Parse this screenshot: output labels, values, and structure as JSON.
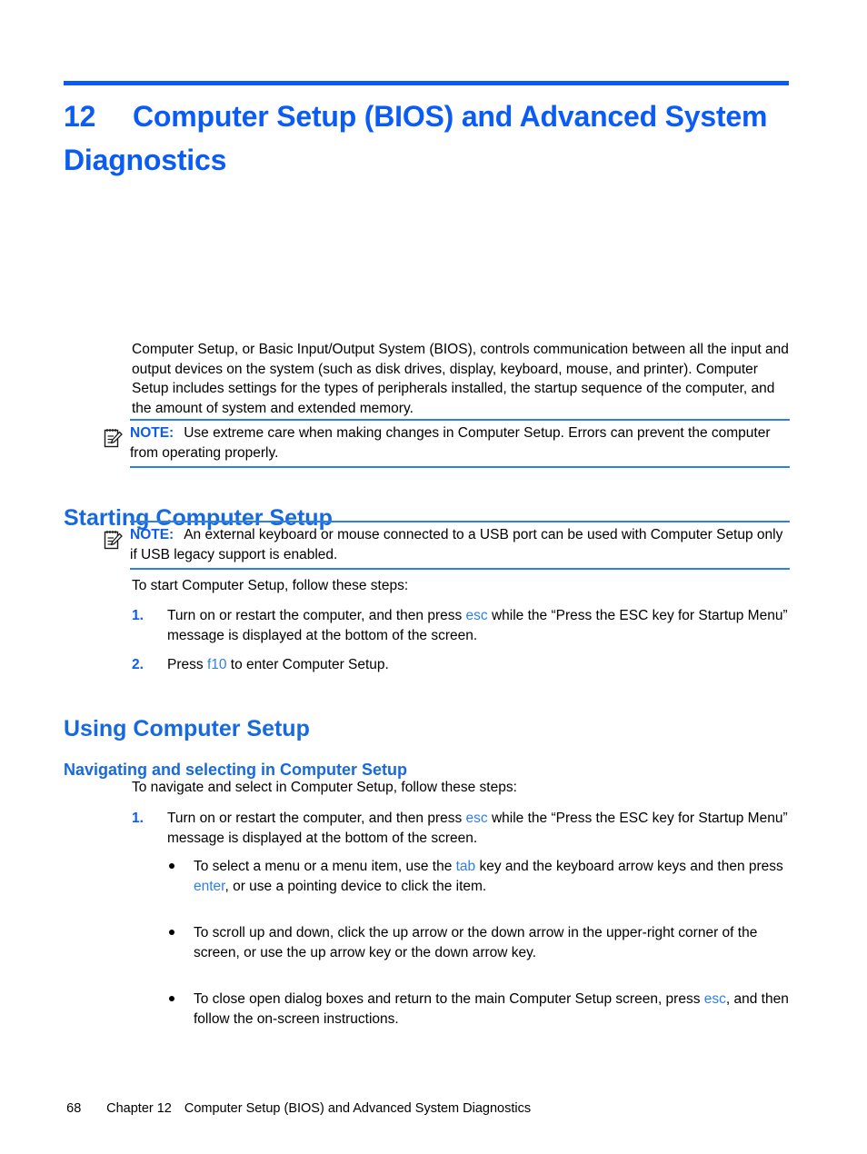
{
  "chapter": {
    "number": "12",
    "title": "Computer Setup (BIOS) and Advanced System Diagnostics"
  },
  "intro": {
    "paragraph": "Computer Setup, or Basic Input/Output System (BIOS), controls communication between all the input and output devices on the system (such as disk drives, display, keyboard, mouse, and printer). Computer Setup includes settings for the types of peripherals installed, the startup sequence of the computer, and the amount of system and extended memory."
  },
  "notes": {
    "label": "NOTE:",
    "first": "Use extreme care when making changes in Computer Setup. Errors can prevent the computer from operating properly.",
    "second": "An external keyboard or mouse connected to a USB port can be used with Computer Setup only if USB legacy support is enabled."
  },
  "sections": {
    "starting": {
      "heading": "Starting Computer Setup",
      "lead": "To start Computer Setup, follow these steps:",
      "steps": [
        {
          "number": "1.",
          "part1": "Turn on or restart the computer, and then press ",
          "key": "esc",
          "part2": " while the “Press the ESC key for Startup Menu” message is displayed at the bottom of the screen."
        },
        {
          "number": "2.",
          "part1": "Press ",
          "key": "f10",
          "part2": " to enter Computer Setup."
        }
      ]
    },
    "using": {
      "heading": "Using Computer Setup",
      "navigating": {
        "heading": "Navigating and selecting in Computer Setup",
        "lead": "To navigate and select in Computer Setup, follow these steps:",
        "steps": [
          {
            "number": "1.",
            "part1": "Turn on or restart the computer, and then press ",
            "key": "esc",
            "part2": " while the “Press the ESC key for Startup Menu” message is displayed at the bottom of the screen."
          }
        ],
        "bullets": [
          {
            "part1": "To select a menu or a menu item, use the ",
            "key1": "tab",
            "part2": " key and the keyboard arrow keys and then press ",
            "key2": "enter",
            "part3": ", or use a pointing device to click the item."
          },
          {
            "part1": "To scroll up and down, click the up arrow or the down arrow in the upper-right corner of the screen, or use the up arrow key or the down arrow key."
          },
          {
            "part1": "To close open dialog boxes and return to the main Computer Setup screen, press ",
            "key1": "esc",
            "part2": ", and then follow the on-screen instructions."
          }
        ]
      }
    }
  },
  "footer": {
    "page_number": "68",
    "chapter_label": "Chapter 12",
    "chapter_title": "Computer Setup (BIOS) and Advanced System Diagnostics"
  },
  "colors": {
    "accent_blue": "#0b5cf5",
    "heading_blue": "#1769e0",
    "key_blue": "#2f7fe8",
    "note_rule": "#2f7fe8"
  }
}
